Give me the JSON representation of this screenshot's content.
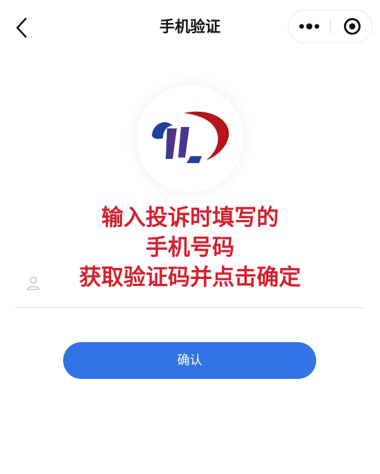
{
  "header": {
    "title": "手机验证"
  },
  "icons": {
    "back": "back-arrow-icon",
    "more": "more-dots-icon",
    "close": "target-close-icon",
    "user": "user-icon"
  },
  "notice": {
    "lines": [
      "输入投诉时填写的",
      "手机号码",
      "获取验证码并点击确定"
    ],
    "color": "#d4202e"
  },
  "form": {
    "phone_placeholder": ""
  },
  "confirm_button": {
    "label": "确认",
    "color": "#3274e3"
  }
}
